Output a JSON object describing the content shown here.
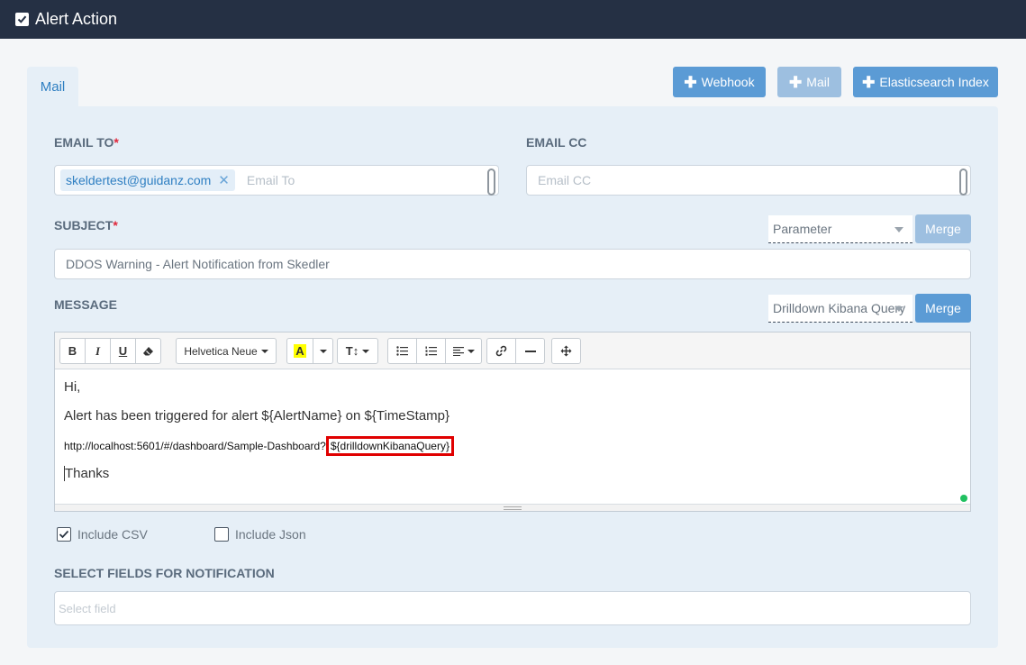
{
  "header": {
    "title": "Alert Action"
  },
  "tabs": [
    {
      "label": "Mail"
    }
  ],
  "actions": {
    "webhook": "Webhook",
    "mail": "Mail",
    "elasticsearch": "Elasticsearch Index"
  },
  "form": {
    "email_to": {
      "label": "EMAIL TO",
      "required_mark": "*",
      "tags": [
        "skeldertest@guidanz.com"
      ],
      "placeholder": "Email To"
    },
    "email_cc": {
      "label": "EMAIL CC",
      "placeholder": "Email CC"
    },
    "subject": {
      "label": "SUBJECT",
      "required_mark": "*",
      "value": "DDOS Warning - Alert Notification from Skedler",
      "param_select": "Parameter",
      "merge": "Merge"
    },
    "message": {
      "label": "MESSAGE",
      "param_select": "Drilldown Kibana Query",
      "merge": "Merge",
      "toolbar": {
        "bold": "B",
        "italic": "I",
        "underline": "U",
        "font": "Helvetica Neue",
        "highlight": "A",
        "textsize": "T↕"
      },
      "body": {
        "line1": "Hi,",
        "line2": "Alert has been triggered for alert ${AlertName} on ${TimeStamp}",
        "url_prefix": "http://localhost:5601/#/dashboard/Sample-Dashboard?",
        "url_param": "${drilldownKibanaQuery}",
        "line4": "Thanks"
      }
    },
    "include_csv": {
      "label": "Include CSV",
      "checked": true
    },
    "include_json": {
      "label": "Include Json",
      "checked": false
    },
    "fields": {
      "label": "SELECT FIELDS FOR NOTIFICATION",
      "placeholder": "Select field"
    }
  },
  "colors": {
    "accent": "#5b9bd5",
    "header_bg": "#253044",
    "panel_bg": "#e6eff7",
    "highlight_border": "#e00000"
  }
}
